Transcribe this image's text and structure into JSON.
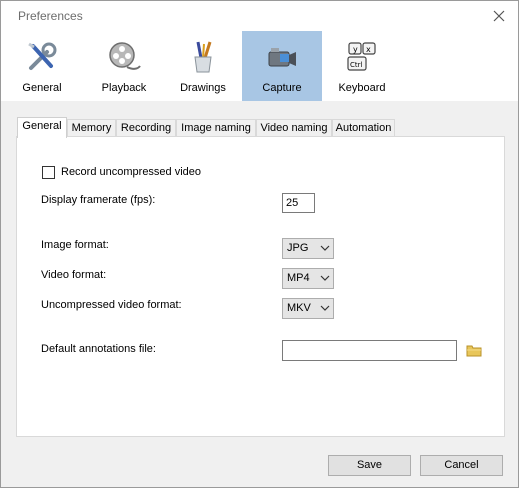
{
  "window": {
    "title": "Preferences"
  },
  "categories": [
    {
      "label": "General",
      "icon": "wrench-screwdriver-icon"
    },
    {
      "label": "Playback",
      "icon": "film-reel-icon"
    },
    {
      "label": "Drawings",
      "icon": "brushes-cup-icon"
    },
    {
      "label": "Capture",
      "icon": "camcorder-icon",
      "active": true
    },
    {
      "label": "Keyboard",
      "icon": "keyboard-keys-icon"
    }
  ],
  "tabs": [
    {
      "label": "General",
      "active": true
    },
    {
      "label": "Memory"
    },
    {
      "label": "Recording"
    },
    {
      "label": "Image naming"
    },
    {
      "label": "Video naming"
    },
    {
      "label": "Automation"
    }
  ],
  "capture_general": {
    "record_uncompressed_label": "Record uncompressed video",
    "record_uncompressed_checked": false,
    "framerate_label": "Display framerate (fps):",
    "framerate_value": "25",
    "image_format_label": "Image format:",
    "image_format_value": "JPG",
    "video_format_label": "Video format:",
    "video_format_value": "MP4",
    "uncompressed_format_label": "Uncompressed video format:",
    "uncompressed_format_value": "MKV",
    "annotations_label": "Default annotations file:",
    "annotations_value": ""
  },
  "buttons": {
    "save": "Save",
    "cancel": "Cancel"
  },
  "colors": {
    "active_category": "#a8c6e4",
    "folder": "#e8c65a"
  }
}
